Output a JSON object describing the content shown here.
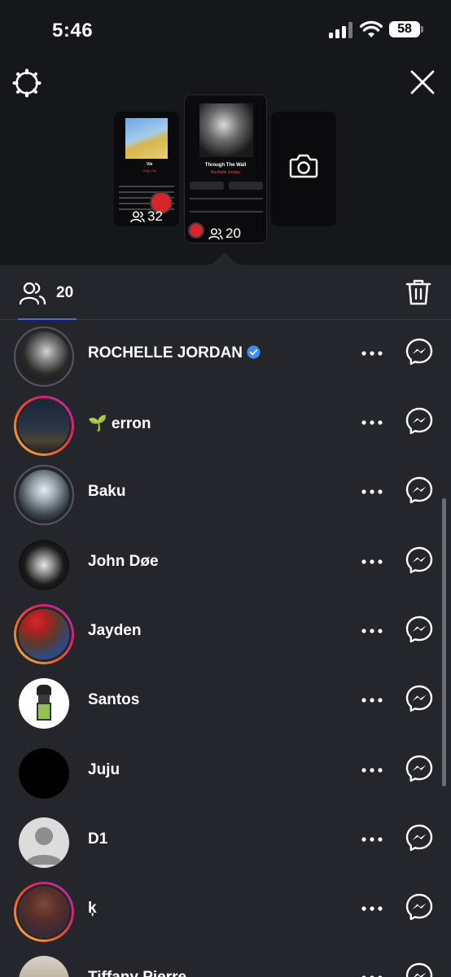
{
  "status_bar": {
    "time": "5:46",
    "battery": "58"
  },
  "story_thumbnails": {
    "left": {
      "viewer_count": "32",
      "song_title": "Vie",
      "song_artist": "Doja Cat"
    },
    "center": {
      "viewer_count": "20",
      "song_title": "Through The Wall",
      "song_artist": "Rochelle Jordan"
    }
  },
  "viewers_tab": {
    "count": "20"
  },
  "viewers": [
    {
      "name": "ROCHELLE JORDAN",
      "verified": true,
      "ring": "seen"
    },
    {
      "name": "🌱 erron",
      "verified": false,
      "ring": "story"
    },
    {
      "name": "Baku",
      "verified": false,
      "ring": "seen"
    },
    {
      "name": "John Døe",
      "verified": false,
      "ring": "none"
    },
    {
      "name": "Jayden",
      "verified": false,
      "ring": "story"
    },
    {
      "name": "Santos",
      "verified": false,
      "ring": "none"
    },
    {
      "name": "Juju",
      "verified": false,
      "ring": "none"
    },
    {
      "name": "D1",
      "verified": false,
      "ring": "none"
    },
    {
      "name": "ķ",
      "verified": false,
      "ring": "story"
    },
    {
      "name": "Tiffany Pierre",
      "verified": false,
      "ring": "none"
    }
  ],
  "colors": {
    "background": "#24262b",
    "top_panel": "#15171b",
    "accent": "#3d6cf0",
    "verified": "#3d8cf5"
  },
  "icons": {
    "settings": "gear-icon",
    "close": "close-icon",
    "camera": "camera-icon",
    "viewers": "people-icon",
    "delete": "trash-icon",
    "more": "more-icon",
    "message": "messenger-icon"
  }
}
